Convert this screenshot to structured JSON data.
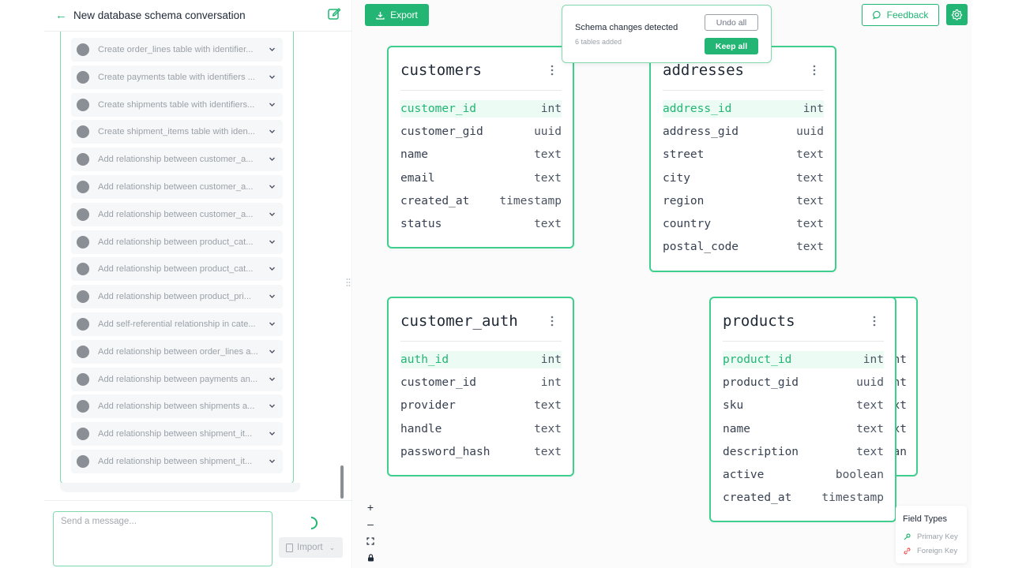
{
  "conversation": {
    "title": "New database schema conversation",
    "tasks": [
      "Create order_lines table with identifier...",
      "Create payments table with identifiers ...",
      "Create shipments table with identifiers...",
      "Create shipment_items table with iden...",
      "Add relationship between customer_a...",
      "Add relationship between customer_a...",
      "Add relationship between customer_a...",
      "Add relationship between product_cat...",
      "Add relationship between product_cat...",
      "Add relationship between product_pri...",
      "Add self-referential relationship in cate...",
      "Add relationship between order_lines a...",
      "Add relationship between payments an...",
      "Add relationship between shipments a...",
      "Add relationship between shipment_it...",
      "Add relationship between shipment_it..."
    ],
    "composer": {
      "placeholder": "Send a message...",
      "import_label": "Import"
    }
  },
  "toolbar": {
    "export_label": "Export",
    "feedback_label": "Feedback"
  },
  "toast": {
    "title": "Schema changes detected",
    "subtitle": "6 tables added",
    "undo_label": "Undo all",
    "keep_label": "Keep all"
  },
  "tables": {
    "customers": {
      "name": "customers",
      "columns": [
        {
          "name": "customer_id",
          "type": "int",
          "pk": true
        },
        {
          "name": "customer_gid",
          "type": "uuid"
        },
        {
          "name": "name",
          "type": "text"
        },
        {
          "name": "email",
          "type": "text"
        },
        {
          "name": "created_at",
          "type": "timestamp"
        },
        {
          "name": "status",
          "type": "text"
        }
      ]
    },
    "addresses": {
      "name": "addresses",
      "columns": [
        {
          "name": "address_id",
          "type": "int",
          "pk": true
        },
        {
          "name": "address_gid",
          "type": "uuid"
        },
        {
          "name": "street",
          "type": "text"
        },
        {
          "name": "city",
          "type": "text"
        },
        {
          "name": "region",
          "type": "text"
        },
        {
          "name": "country",
          "type": "text"
        },
        {
          "name": "postal_code",
          "type": "text"
        }
      ]
    },
    "customer_auth": {
      "name": "customer_auth",
      "columns": [
        {
          "name": "auth_id",
          "type": "int",
          "pk": true
        },
        {
          "name": "customer_id",
          "type": "int"
        },
        {
          "name": "provider",
          "type": "text"
        },
        {
          "name": "handle",
          "type": "text"
        },
        {
          "name": "password_hash",
          "type": "text"
        }
      ]
    },
    "products": {
      "name": "products",
      "columns": [
        {
          "name": "product_id",
          "type": "int",
          "pk": true
        },
        {
          "name": "product_gid",
          "type": "uuid"
        },
        {
          "name": "sku",
          "type": "text"
        },
        {
          "name": "name",
          "type": "text"
        },
        {
          "name": "description",
          "type": "text"
        },
        {
          "name": "active",
          "type": "boolean"
        },
        {
          "name": "created_at",
          "type": "timestamp"
        }
      ]
    },
    "hidden_card_fragments": [
      "nt",
      "nt",
      "xt",
      "xt",
      "an"
    ]
  },
  "legend": {
    "title": "Field Types",
    "primary_label": "Primary Key",
    "foreign_label": "Foreign Key",
    "primary_color": "#22b573",
    "foreign_color": "#ef4444"
  },
  "colors": {
    "accent": "#22b573",
    "accent_border": "#3ecf8e",
    "pk_highlight": "#ecfbf3"
  }
}
